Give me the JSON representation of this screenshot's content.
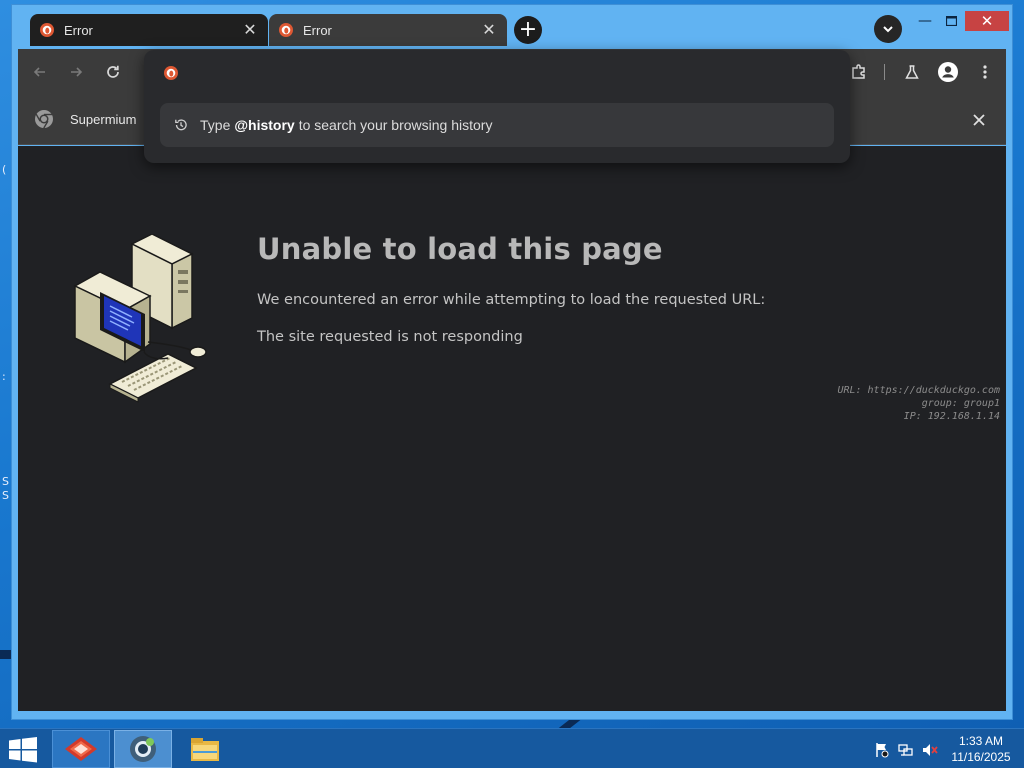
{
  "browser": {
    "tabs": [
      {
        "title": "Error",
        "active": false
      },
      {
        "title": "Error",
        "active": true
      }
    ],
    "omnibox": {
      "value": "",
      "suggestion_prefix": "Type",
      "suggestion_keyword": "@history",
      "suggestion_suffix": "to search your browsing history"
    },
    "bookmarks": [
      {
        "label": "Supermium"
      }
    ]
  },
  "page": {
    "title": "Unable to load this page",
    "message": "We encountered an error while attempting to load the requested URL:",
    "reason": "The site requested is not responding",
    "meta": {
      "url": "URL: https://duckduckgo.com",
      "group": "group: group1",
      "ip": "IP: 192.168.1.14"
    }
  },
  "desktop": {
    "edge_text": [
      "(",
      ":",
      "S",
      "S"
    ]
  },
  "taskbar": {
    "apps": [
      {
        "name": "gitextensions-icon"
      },
      {
        "name": "supermium-icon"
      },
      {
        "name": "file-explorer-icon"
      }
    ],
    "clock": {
      "time": "1:33 AM",
      "date": "11/16/2025"
    }
  },
  "colors": {
    "page_bg": "#202124",
    "toolbar_bg": "#3b3b3b",
    "omnibox_bg": "#292a2d",
    "accent_duckduckgo": "#de5833",
    "taskbar_bg": "#16599f"
  }
}
